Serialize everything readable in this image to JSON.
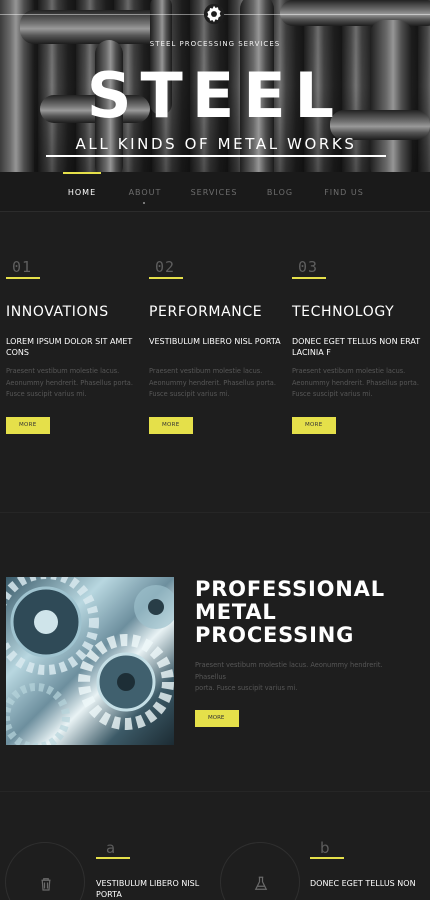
{
  "hero": {
    "tagline": "STEEL PROCESSING SERVICES",
    "title": "STEEL",
    "subtitle": "ALL KINDS OF METAL WORKS",
    "icon": "gear-icon"
  },
  "nav": {
    "items": [
      {
        "label": "HOME",
        "active": true
      },
      {
        "label": "ABOUT",
        "active": false
      },
      {
        "label": "SERVICES",
        "active": false
      },
      {
        "label": "BLOG",
        "active": false
      },
      {
        "label": "FIND US",
        "active": false
      }
    ]
  },
  "features": [
    {
      "number": "01",
      "title": "INNOVATIONS",
      "subtitle": "LOREM IPSUM DOLOR SIT AMET CONS",
      "text": "Praesent vestibum molestie lacus. Aeonummy hendrerit. Phasellus porta. Fusce suscipit varius mi.",
      "button": "MORE"
    },
    {
      "number": "02",
      "title": "PERFORMANCE",
      "subtitle": "VESTIBULUM LIBERO NISL PORTA",
      "text": "Praesent vestibum molestie lacus. Aeonummy hendrerit. Phasellus porta. Fusce suscipit varius mi.",
      "button": "MORE"
    },
    {
      "number": "03",
      "title": "TECHNOLOGY",
      "subtitle": "DONEC EGET TELLUS NON ERAT LACINIA F",
      "text": "Praesent vestibum molestie lacus. Aeonummy hendrerit. Phasellus porta. Fusce suscipit varius mi.",
      "button": "MORE"
    }
  ],
  "promo": {
    "title_line1": "PROFESSIONAL",
    "title_line2": "METAL",
    "title_line3": "PROCESSING",
    "text_line1": "Praesent vestibum molestie lacus. Aeonummy hendrerit. Phasellus",
    "text_line2": "porta. Fusce suscipit varius mi.",
    "button": "MORE"
  },
  "bottom": [
    {
      "letter": "a",
      "subtitle": "VESTIBULUM LIBERO NISL PORTA",
      "icon": "trash-icon"
    },
    {
      "letter": "b",
      "subtitle": "DONEC EGET TELLUS NON",
      "icon": "flask-icon"
    }
  ],
  "colors": {
    "accent": "#e5e04a",
    "background": "#1e1e1e",
    "muted_text": "#575757"
  }
}
